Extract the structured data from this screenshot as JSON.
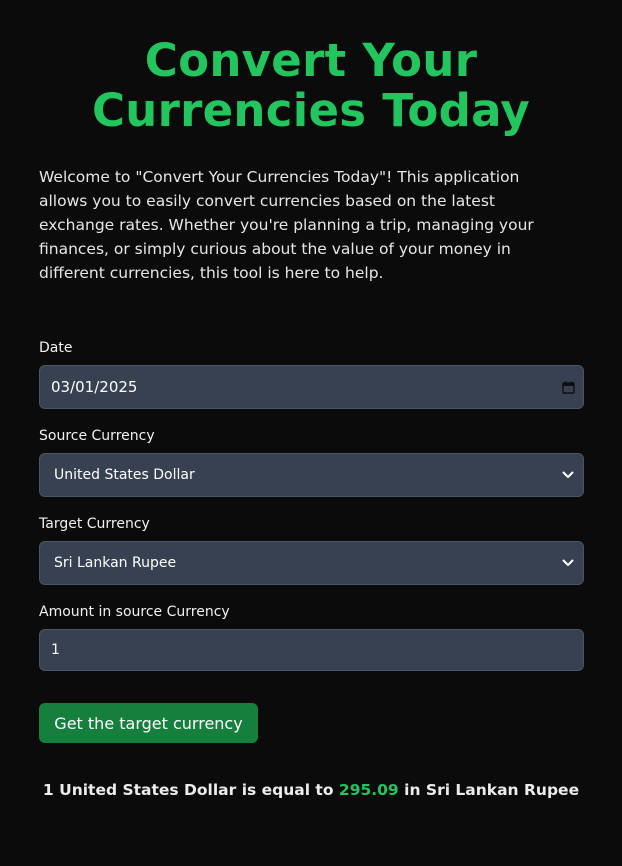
{
  "title_line1": "Convert Your",
  "title_line2": "Currencies Today",
  "intro": "Welcome to \"Convert Your Currencies Today\"! This application allows you to easily convert currencies based on the latest exchange rates. Whether you're planning a trip, managing your finances, or simply curious about the value of your money in different currencies, this tool is here to help.",
  "form": {
    "date_label": "Date",
    "date_value": "03/01/2025",
    "source_label": "Source Currency",
    "source_value": "United States Dollar",
    "target_label": "Target Currency",
    "target_value": "Sri Lankan Rupee",
    "amount_label": "Amount in source Currency",
    "amount_value": "1",
    "submit_label": "Get the target currency"
  },
  "result": {
    "amount": "1",
    "source": "United States Dollar",
    "is_equal_to": "is equal to",
    "rate": "295.09",
    "in_word": "in",
    "target": "Sri Lankan Rupee"
  },
  "colors": {
    "accent": "#22c55e",
    "button": "#15803d",
    "field_bg": "#374151",
    "page_bg": "#0b0b0c"
  },
  "icons": {
    "date_icon": "calendar-icon",
    "select_icon": "chevron-down-icon"
  }
}
